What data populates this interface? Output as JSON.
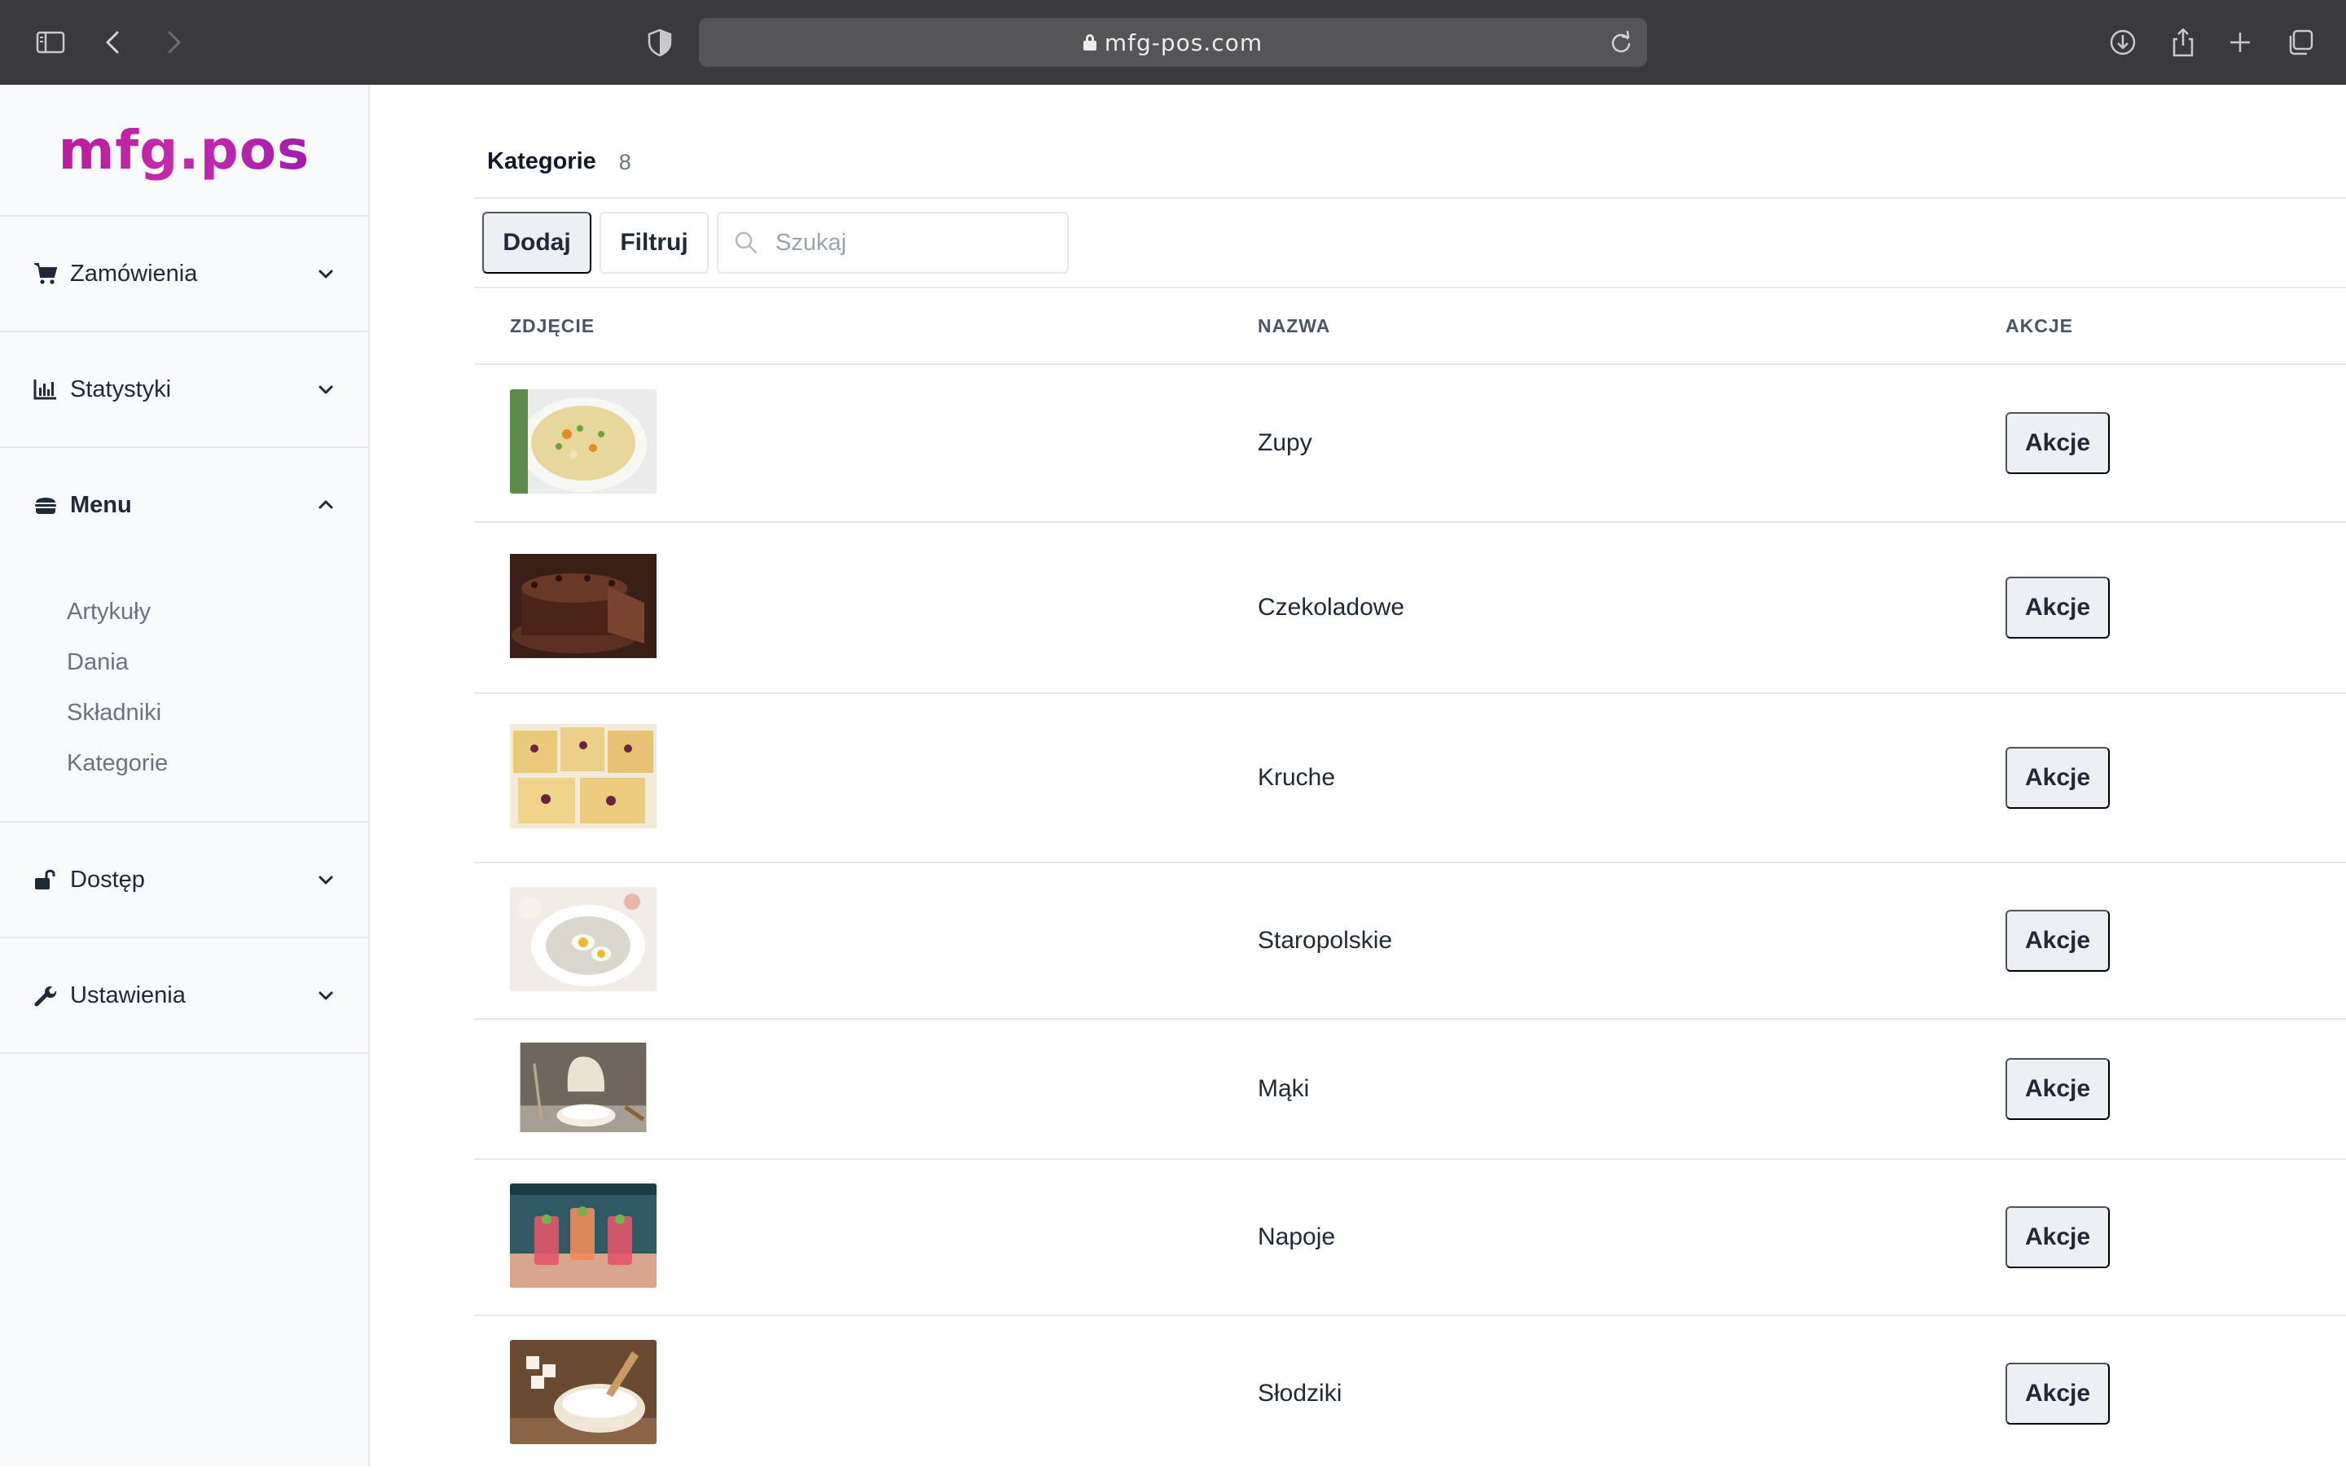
{
  "browser": {
    "url": "mfg-pos.com",
    "icons": [
      "sidebar-icon",
      "back-icon",
      "forward-icon",
      "shield-icon",
      "lock-icon",
      "reload-icon",
      "download-icon",
      "share-icon",
      "new-tab-icon",
      "tabs-icon"
    ]
  },
  "brand": {
    "name": "mfg.pos",
    "color": "#c025a8"
  },
  "sidebar": {
    "sections": [
      {
        "label": "Zamówienia",
        "icon": "cart-icon",
        "expanded": false
      },
      {
        "label": "Statystyki",
        "icon": "bar-chart-icon",
        "expanded": false
      },
      {
        "label": "Menu",
        "icon": "burger-icon",
        "expanded": true,
        "items": [
          "Artykuły",
          "Dania",
          "Składniki",
          "Kategorie"
        ]
      },
      {
        "label": "Dostęp",
        "icon": "unlock-icon",
        "expanded": false
      },
      {
        "label": "Ustawienia",
        "icon": "wrench-icon",
        "expanded": false
      }
    ]
  },
  "main": {
    "title": "Kategorie",
    "count": "8",
    "toolbar": {
      "add_label": "Dodaj",
      "filter_label": "Filtruj",
      "search_placeholder": "Szukaj"
    },
    "table": {
      "columns": [
        "ZDJĘCIE",
        "NAZWA",
        "AKCJE"
      ],
      "action_label": "Akcje",
      "rows": [
        {
          "name": "Zupy",
          "image": "soup-photo"
        },
        {
          "name": "Czekoladowe",
          "image": "chocolate-cake-photo"
        },
        {
          "name": "Kruche",
          "image": "crumble-cake-photo"
        },
        {
          "name": "Staropolskie",
          "image": "sour-soup-photo"
        },
        {
          "name": "Mąki",
          "image": "flour-photo"
        },
        {
          "name": "Napoje",
          "image": "drinks-photo"
        },
        {
          "name": "Słodziki",
          "image": "sugar-photo"
        }
      ]
    }
  }
}
